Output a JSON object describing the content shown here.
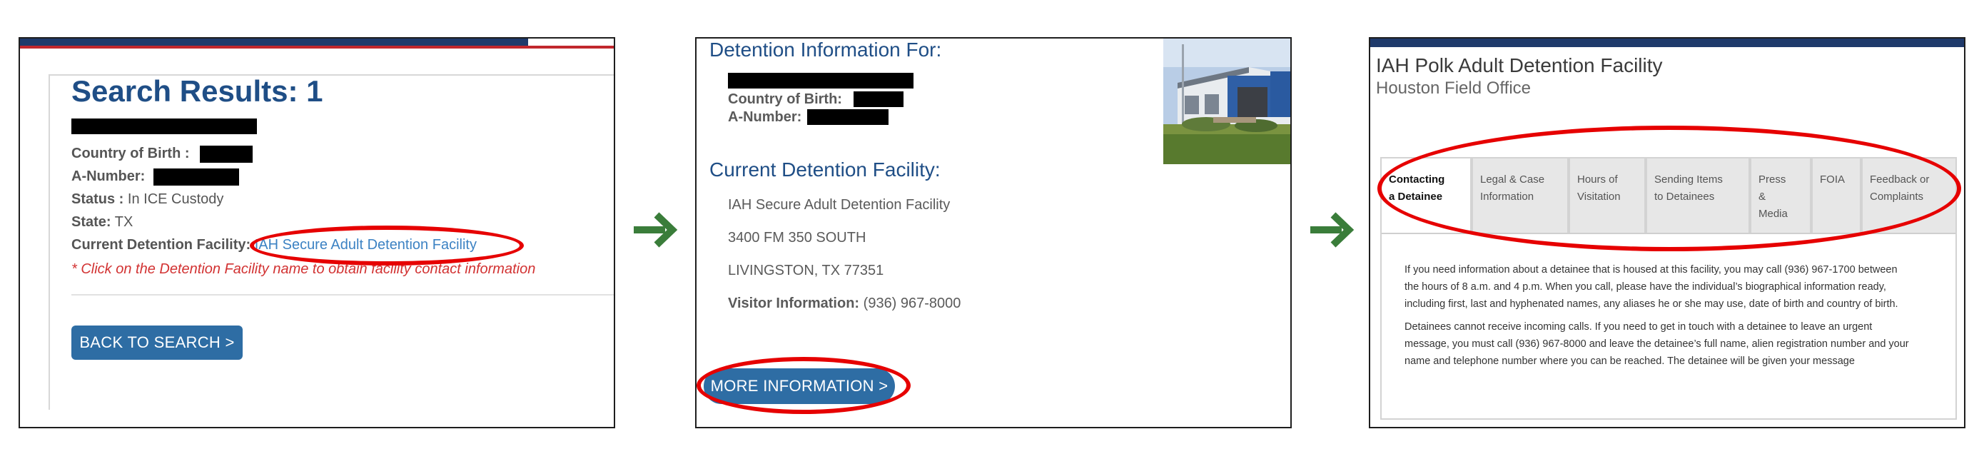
{
  "colors": {
    "highlight": "#e60000",
    "arrow": "#3a7d3a",
    "link": "#3c82c3",
    "heading": "#1f4e86",
    "button": "#2e6da4"
  },
  "panel1": {
    "title": "Search Results: 1",
    "country_label": "Country of Birth :",
    "anumber_label": "A-Number:",
    "status_label": "Status :",
    "status_value": "In ICE Custody",
    "state_label": "State:",
    "state_value": "TX",
    "facility_label": "Current Detention Facility:",
    "facility_link": "IAH Secure Adult Detention Facility",
    "note": "* Click on the Detention Facility name to obtain facility contact information",
    "back_button": "BACK TO SEARCH >"
  },
  "panel2": {
    "heading": "Detention Information For:",
    "country_label": "Country of Birth:",
    "anumber_label": "A-Number:",
    "facility_heading": "Current Detention Facility:",
    "facility_name": "IAH Secure Adult Detention Facility",
    "address_line1": "3400 FM 350 SOUTH",
    "address_line2": "LIVINGSTON, TX 77351",
    "visitor_label": "Visitor Information:",
    "visitor_phone": "(936) 967-8000",
    "more_button": "MORE INFORMATION >"
  },
  "panel3": {
    "facility_title": "IAH Polk Adult Detention Facility",
    "office": "Houston Field Office",
    "tabs": [
      {
        "line1": "Contacting",
        "line2": "a Detainee",
        "line3": ""
      },
      {
        "line1": "Legal & Case",
        "line2": "Information",
        "line3": ""
      },
      {
        "line1": "Hours of",
        "line2": "Visitation",
        "line3": ""
      },
      {
        "line1": "Sending Items",
        "line2": "to Detainees",
        "line3": ""
      },
      {
        "line1": "Press",
        "line2": "&",
        "line3": "Media"
      },
      {
        "line1": "FOIA",
        "line2": "",
        "line3": ""
      },
      {
        "line1": "Feedback or",
        "line2": "Complaints",
        "line3": ""
      }
    ],
    "para1": {
      "l1": "If you need information about a detainee that is housed at this facility, you may call (936) 967-1700 between",
      "l2": "the hours of 8 a.m. and 4 p.m. When you call, please have the individual’s biographical information ready,",
      "l3": "including first, last and hyphenated names, any aliases he or she may use, date of birth and country of birth."
    },
    "para2": {
      "l1": "Detainees cannot receive incoming calls. If you need to get in touch with a detainee to leave an urgent",
      "l2": "message, you must call (936) 967-8000 and leave the detainee’s full name, alien registration number and your",
      "l3": "name and telephone number where you can be reached. The detainee will be given your message"
    }
  }
}
